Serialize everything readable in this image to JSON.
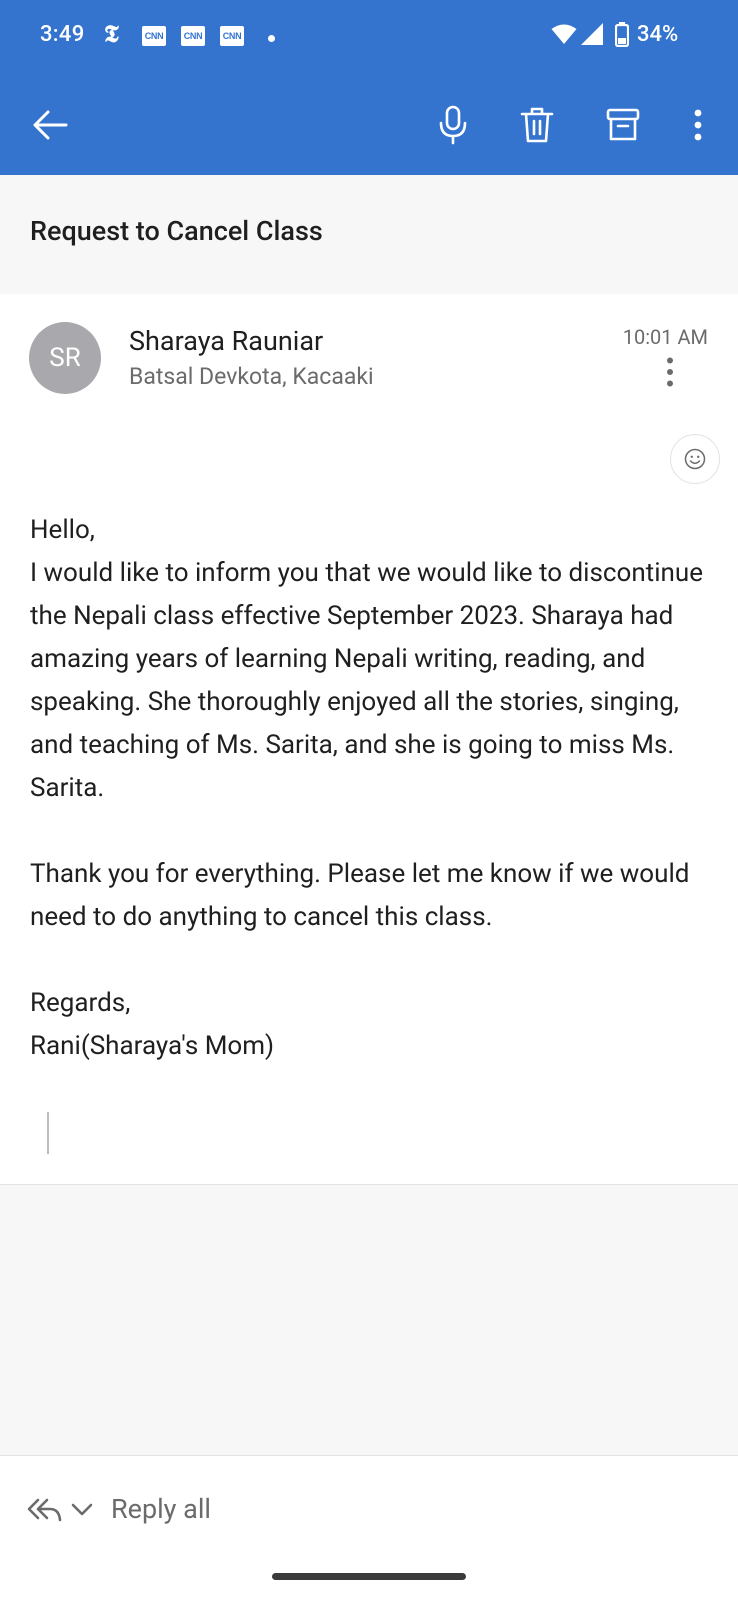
{
  "status_bar": {
    "time": "3:49",
    "nyt_glyph": "𝕿",
    "notification_icons": [
      "nyt-icon",
      "cnn-icon",
      "cnn-icon",
      "cnn-icon",
      "dot-icon"
    ],
    "cnn_label": "CNN",
    "battery": "34%"
  },
  "toolbar": {
    "back": "arrow-left-icon",
    "actions": [
      "microphone-icon",
      "trash-icon",
      "archive-icon",
      "more-vertical-icon"
    ],
    "color": "#3474cf"
  },
  "email": {
    "subject": "Request to Cancel Class",
    "avatar_initials": "SR",
    "sender": "Sharaya Rauniar",
    "recipients": "Batsal Devkota, Kacaaki",
    "time": "10:01 AM",
    "body": [
      "Hello,\nI would like to inform you that we would like to discontinue the Nepali class effective September 2023. Sharaya had amazing years of learning Nepali writing, reading, and speaking. She thoroughly enjoyed all the stories, singing, and teaching of Ms. Sarita, and she is going to miss Ms. Sarita.",
      "Thank you for everything. Please let me know if we would need to do anything to cancel this class.",
      "Regards,\nRani(Sharaya's Mom)"
    ]
  },
  "reply_bar": {
    "label": "Reply all"
  }
}
